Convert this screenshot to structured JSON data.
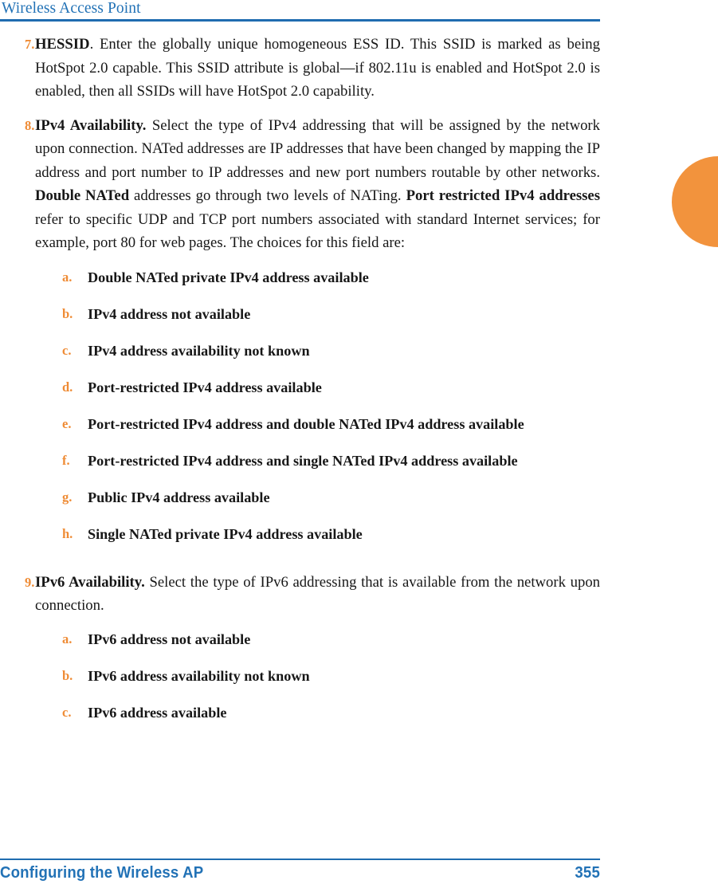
{
  "header": {
    "title": "Wireless Access Point",
    "rule_color": "#1f6cb0"
  },
  "colors": {
    "accent_blue": "#2272b6",
    "marker_orange": "#ef8c36",
    "tab_orange": "#f2933d",
    "body_text": "#171717"
  },
  "thumb_tab": {
    "name": "chapter-thumb-tab",
    "color": "#f2933d"
  },
  "content": {
    "items": [
      {
        "marker": "7.",
        "lead": "HESSID",
        "text_after_lead": ". Enter the globally unique homogeneous ESS ID. This SSID is marked as being HotSpot 2.0 capable. This SSID attribute is global—if 802.11u is enabled and HotSpot 2.0 is enabled, then all SSIDs will have HotSpot 2.0 capability."
      },
      {
        "marker": "8.",
        "lead": "IPv4 Availability.",
        "text_after_lead": " Select the type of IPv4 addressing that will be assigned by the network upon connection. NATed addresses are IP addresses that have been changed by mapping the IP address and port number to IP addresses and new port numbers routable by other networks. ",
        "emphasis_1": "Double NATed",
        "text_mid_1": " addresses go through two levels of NATing. ",
        "emphasis_2": "Port restricted IPv4 addresses",
        "text_tail": " refer to specific UDP and TCP port numbers associated with standard Internet services; for example, port 80 for web pages. The choices for this field are:"
      },
      {
        "marker": "9.",
        "lead": "IPv6 Availability.",
        "text_after_lead": " Select the type of IPv6 addressing that is available from the network upon connection."
      }
    ],
    "ipv4_choices": [
      {
        "marker": "a.",
        "label": "Double NATed private IPv4 address available"
      },
      {
        "marker": "b.",
        "label": "IPv4 address not available"
      },
      {
        "marker": "c.",
        "label": "IPv4 address availability not known"
      },
      {
        "marker": "d.",
        "label": "Port-restricted IPv4 address available"
      },
      {
        "marker": "e.",
        "label": "Port-restricted IPv4 address and double NATed IPv4 address available"
      },
      {
        "marker": "f.",
        "label": "Port-restricted IPv4 address and single NATed IPv4 address available"
      },
      {
        "marker": "g.",
        "label": "Public IPv4 address available"
      },
      {
        "marker": "h.",
        "label": "Single NATed private IPv4 address available"
      }
    ],
    "ipv6_choices": [
      {
        "marker": "a.",
        "label": "IPv6 address not available"
      },
      {
        "marker": "b.",
        "label": "IPv6 address availability not known"
      },
      {
        "marker": "c.",
        "label": "IPv6 address available"
      }
    ]
  },
  "footer": {
    "left_text": "Configuring the Wireless AP",
    "page_number": "355",
    "rule_color": "#1f6cb0"
  }
}
